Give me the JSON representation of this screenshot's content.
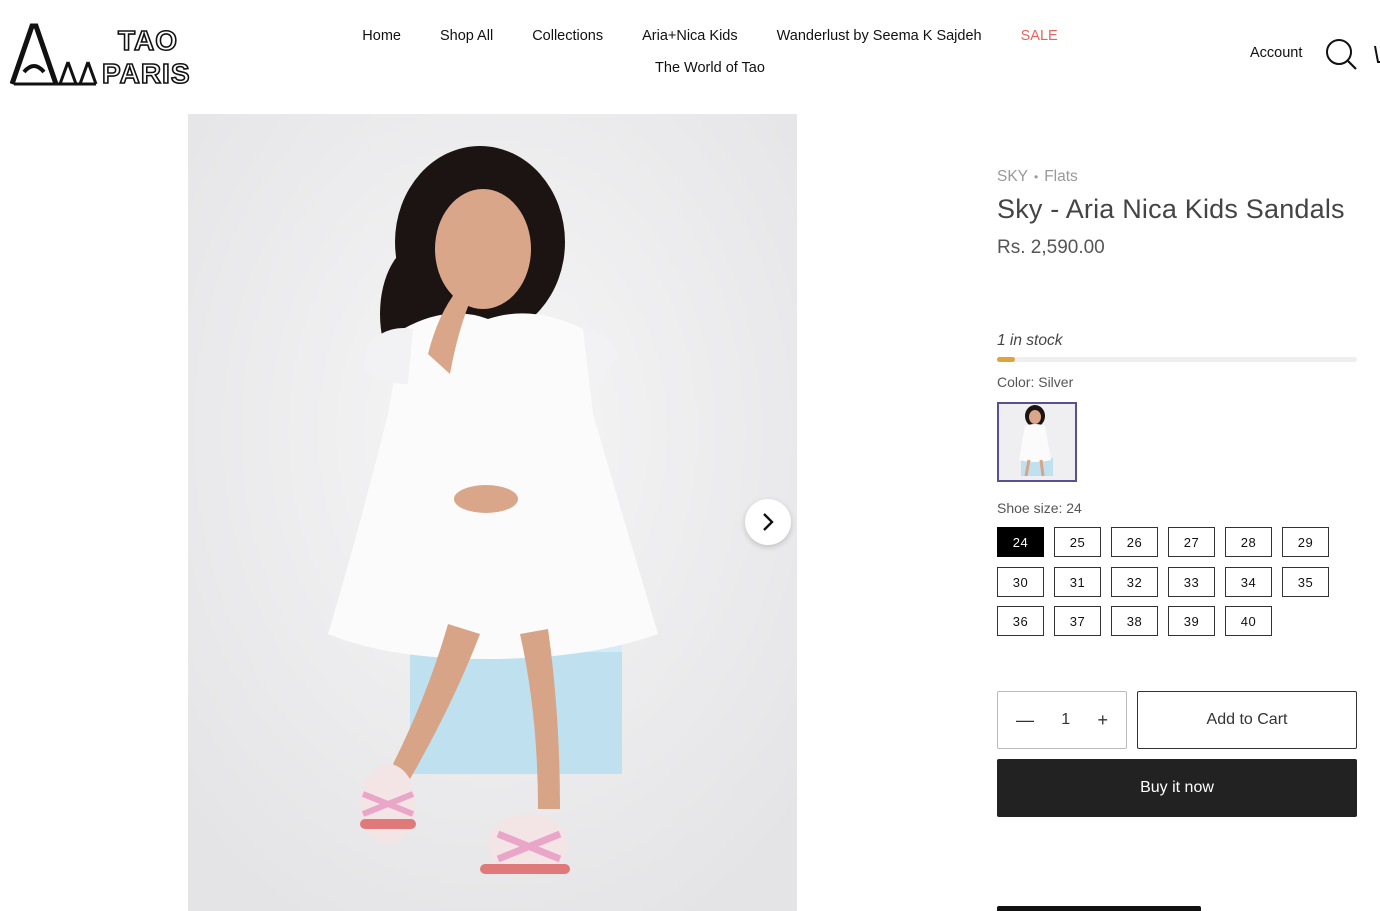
{
  "brand": {
    "logo_text_top": "TAO",
    "logo_text_bottom": "PARIS"
  },
  "nav": {
    "row1": [
      "Home",
      "Shop All",
      "Collections",
      "Aria+Nica Kids",
      "Wanderlust by Seema K Sajdeh",
      "SALE"
    ],
    "row2": [
      "The World of Tao"
    ],
    "account_label": "Account",
    "sale_color": "#e5645f"
  },
  "icons": {
    "search": "search-icon",
    "cart": "cart-icon",
    "next": "chevron-right-icon"
  },
  "product": {
    "vendor": "SKY",
    "type": "Flats",
    "title": "Sky - Aria Nica Kids Sandals",
    "price": "Rs. 2,590.00",
    "stock_text": "1 in stock",
    "stock_level_fraction": 0.05,
    "stock_color": "#e0a23b",
    "color_label": "Color: Silver",
    "size_label": "Shoe size: 24",
    "sizes": [
      "24",
      "25",
      "26",
      "27",
      "28",
      "29",
      "30",
      "31",
      "32",
      "33",
      "34",
      "35",
      "36",
      "37",
      "38",
      "39",
      "40"
    ],
    "selected_size": "24",
    "quantity": "1",
    "add_to_cart_label": "Add to Cart",
    "buy_now_label": "Buy it now"
  }
}
